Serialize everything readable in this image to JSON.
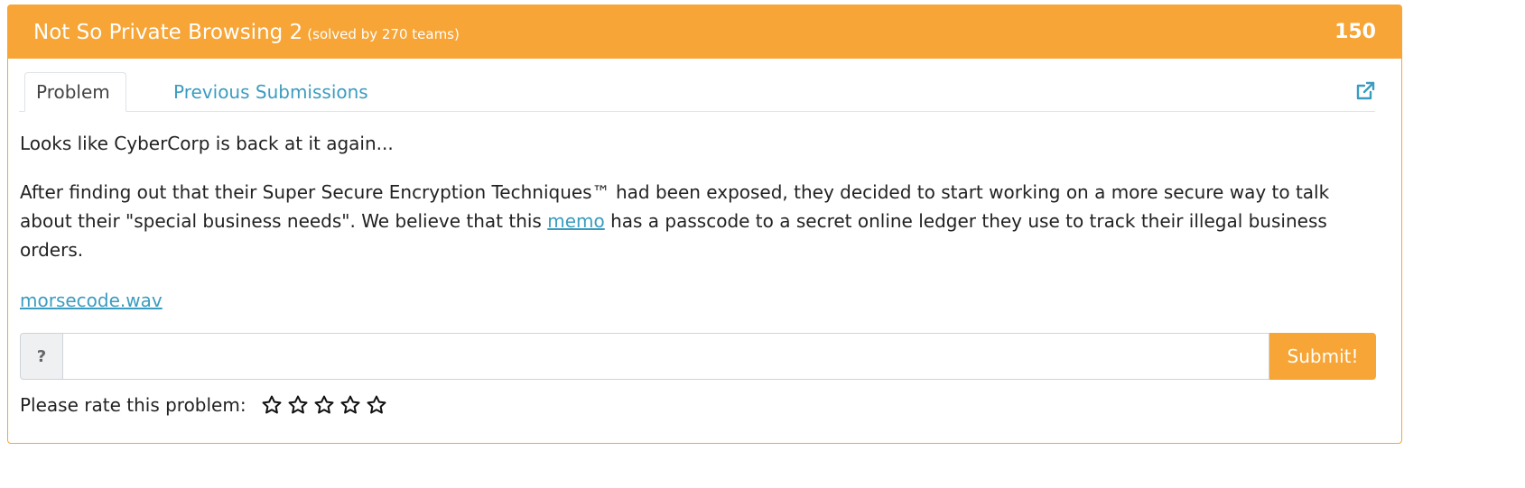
{
  "header": {
    "title": "Not So Private Browsing 2",
    "solved": "(solved by 270 teams)",
    "points": "150"
  },
  "tabs": [
    {
      "label": "Problem"
    },
    {
      "label": "Previous Submissions"
    }
  ],
  "problem": {
    "intro": "Looks like CyberCorp is back at it again...",
    "body_before": "After finding out that their Super Secure Encryption Techniques™ had been exposed, they decided to start working on a more secure way to talk about their \"special business needs\". We believe that this ",
    "memo_link": "memo",
    "body_after": " has a passcode to a secret online ledger they use to track their illegal business orders.",
    "file_link": "morsecode.wav"
  },
  "submission": {
    "addon": "?",
    "value": "",
    "placeholder": "",
    "submit_label": "Submit!"
  },
  "rating": {
    "label": "Please rate this problem:",
    "stars_total": 5,
    "stars_filled": 0
  },
  "colors": {
    "accent": "#f6a536",
    "link": "#3b9cbf"
  },
  "icons": {
    "external_link": "external-link-icon",
    "star": "star-outline-icon"
  }
}
